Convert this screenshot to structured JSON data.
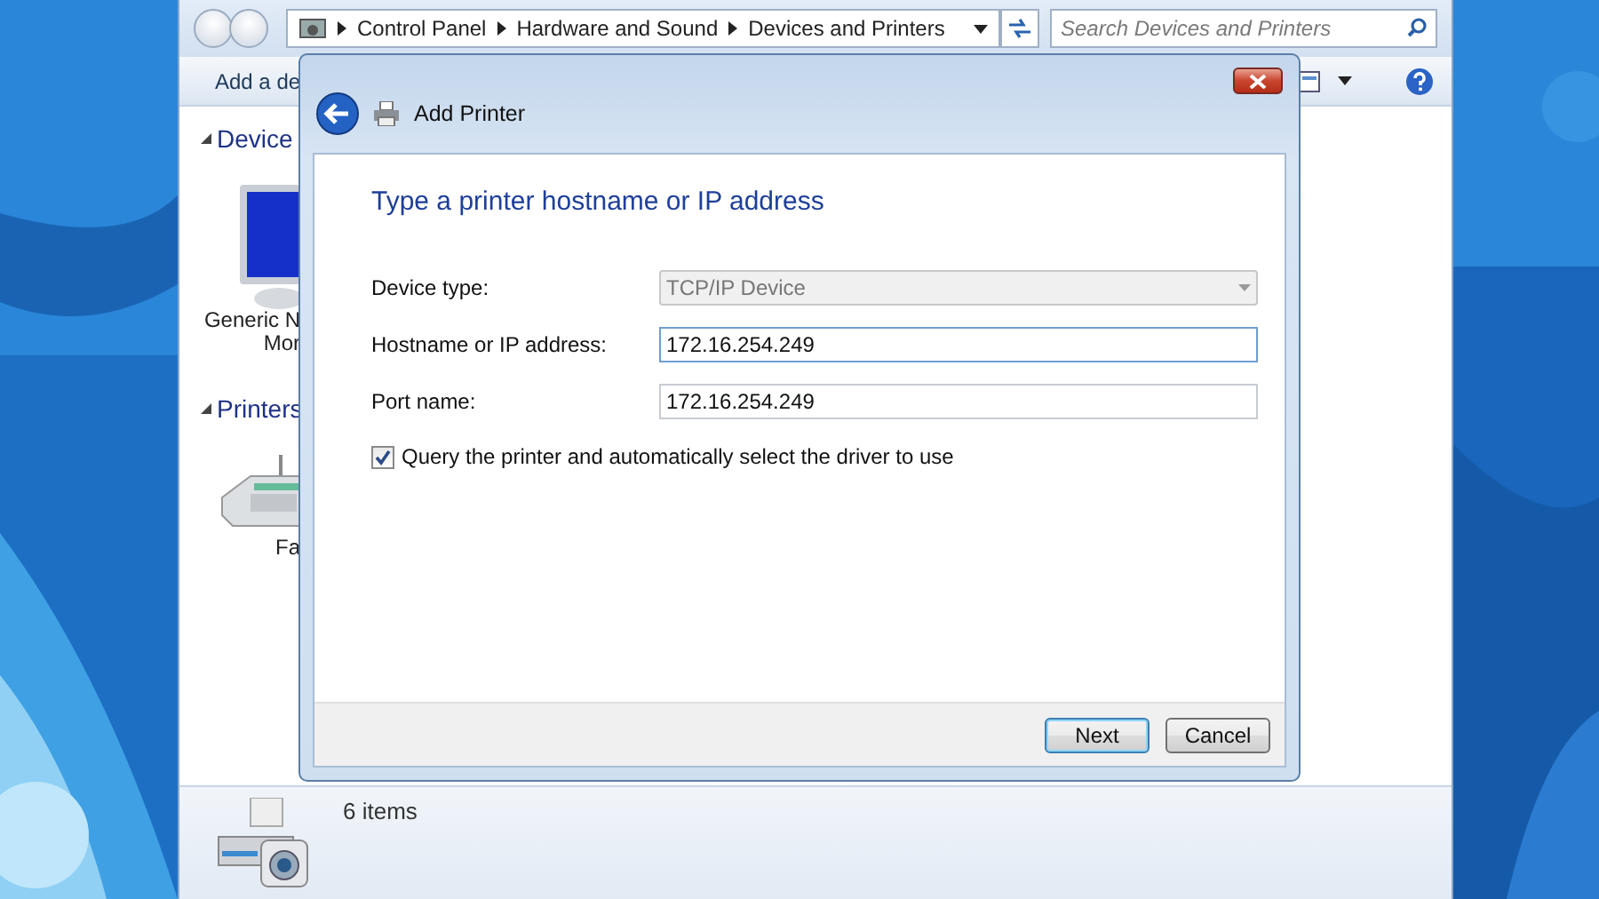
{
  "address_bar": {
    "crumbs": [
      "Control Panel",
      "Hardware and Sound",
      "Devices and Printers"
    ]
  },
  "search": {
    "placeholder": "Search Devices and Printers"
  },
  "toolbar": {
    "items": [
      "Add a de"
    ]
  },
  "groups": [
    {
      "title": "Device",
      "expanded": true,
      "items": [
        {
          "kind": "monitor",
          "label_lines": [
            "Generic N",
            "Mor"
          ]
        }
      ]
    },
    {
      "title": "Printers",
      "expanded": true,
      "items": [
        {
          "kind": "fax",
          "label_lines": [
            "Fa"
          ]
        }
      ]
    }
  ],
  "details": {
    "count": "6 items"
  },
  "dialog": {
    "title": "Add Printer",
    "heading": "Type a printer hostname or IP address",
    "fields": [
      {
        "label": "Device type:",
        "kind": "dropdown",
        "value": "TCP/IP Device",
        "disabled": true,
        "focused": false
      },
      {
        "label": "Hostname or IP address:",
        "kind": "text",
        "value": "172.16.254.249",
        "disabled": false,
        "focused": true
      },
      {
        "label": "Port name:",
        "kind": "text",
        "value": "172.16.254.249",
        "disabled": false,
        "focused": false
      }
    ],
    "query": {
      "label": "Query the printer and automatically select the driver to use",
      "checked": true
    },
    "buttons": [
      {
        "label": "Next",
        "default": true
      },
      {
        "label": "Cancel",
        "default": false
      }
    ]
  }
}
